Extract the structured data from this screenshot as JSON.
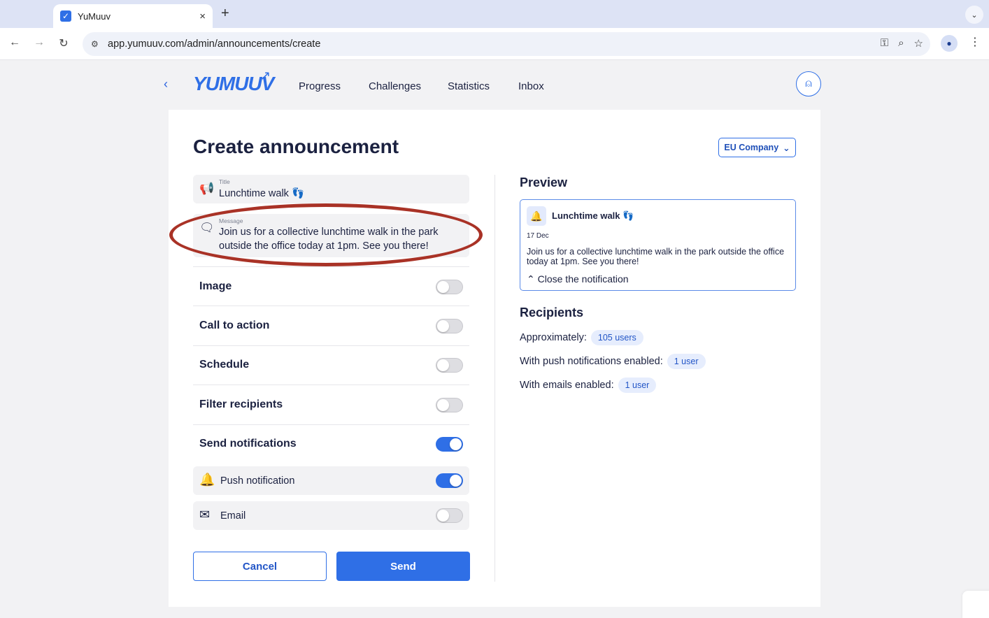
{
  "browser": {
    "tab_title": "YuMuuv",
    "tab_favicon": "✓",
    "new_tab": "+",
    "close_tab": "×",
    "url": "app.yumuuv.com/admin/announcements/create"
  },
  "app": {
    "logo": "YUMUUV",
    "nav": [
      "Progress",
      "Challenges",
      "Statistics",
      "Inbox"
    ]
  },
  "page": {
    "title": "Create announcement",
    "company": "EU Company"
  },
  "form": {
    "title_label": "Title",
    "title_value": "Lunchtime walk 👣",
    "message_label": "Message",
    "message_value": "Join us for a collective lunchtime walk in the park outside the office today at 1pm. See you there!",
    "toggles": [
      {
        "label": "Image",
        "on": false
      },
      {
        "label": "Call to action",
        "on": false
      },
      {
        "label": "Schedule",
        "on": false
      },
      {
        "label": "Filter recipients",
        "on": false
      },
      {
        "label": "Send notifications",
        "on": true
      }
    ],
    "push_label": "Push notification",
    "push_on": true,
    "email_label": "Email",
    "email_on": false,
    "cancel": "Cancel",
    "send": "Send"
  },
  "preview": {
    "heading": "Preview",
    "title": "Lunchtime walk 👣",
    "date": "17 Dec",
    "body": "Join us for a collective lunchtime walk in the park outside the office today at 1pm. See you there!",
    "close": "Close the notification"
  },
  "recipients": {
    "heading": "Recipients",
    "approx_label": "Approximately:",
    "approx_value": "105 users",
    "push_label": "With push notifications enabled:",
    "push_value": "1 user",
    "email_label": "With emails enabled:",
    "email_value": "1 user"
  },
  "colors": {
    "accent": "#2f6fe6",
    "highlight": "#a93226"
  }
}
